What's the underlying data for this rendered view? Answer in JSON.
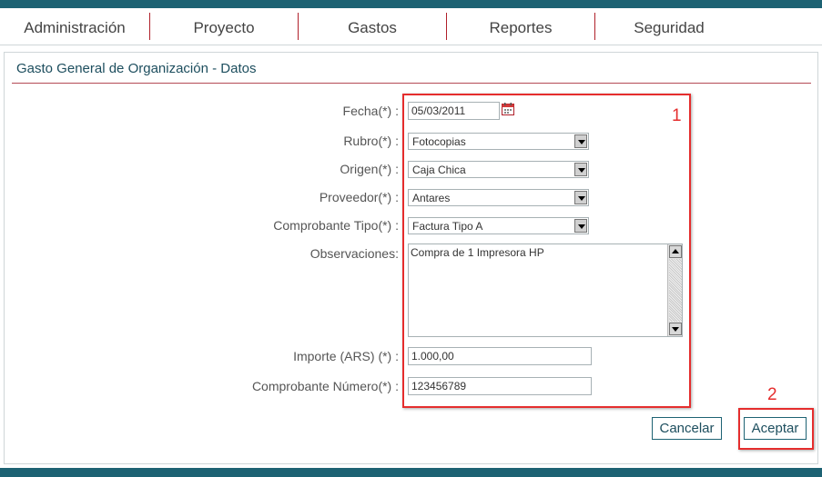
{
  "nav": {
    "items": [
      "Administración",
      "Proyecto",
      "Gastos",
      "Reportes",
      "Seguridad"
    ]
  },
  "panel": {
    "title": "Gasto General de Organización - Datos"
  },
  "form": {
    "fecha": {
      "label": "Fecha(*) :",
      "value": "05/03/2011"
    },
    "rubro": {
      "label": "Rubro(*) :",
      "value": "Fotocopias"
    },
    "origen": {
      "label": "Origen(*) :",
      "value": "Caja Chica"
    },
    "proveedor": {
      "label": "Proveedor(*) :",
      "value": "Antares"
    },
    "comprobante_tipo": {
      "label": "Comprobante Tipo(*) :",
      "value": "Factura Tipo A"
    },
    "observaciones": {
      "label": "Observaciones:",
      "value": "Compra de 1 Impresora HP"
    },
    "importe": {
      "label": "Importe (ARS) (*) :",
      "value": "1.000,00"
    },
    "comprobante_numero": {
      "label": "Comprobante Número(*) :",
      "value": "123456789"
    }
  },
  "buttons": {
    "cancel": "Cancelar",
    "accept": "Aceptar"
  },
  "annotations": {
    "one": "1",
    "two": "2"
  },
  "colors": {
    "brand": "#1d6273",
    "accent": "#b0202a",
    "annotation": "#e52d2d"
  },
  "icons": {
    "calendar": "calendar-icon"
  }
}
